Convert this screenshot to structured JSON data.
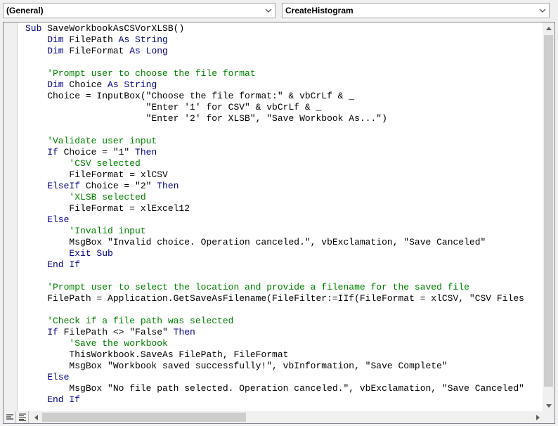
{
  "object_combo": {
    "value": "(General)"
  },
  "procedure_combo": {
    "value": "CreateHistogram"
  },
  "icons": {
    "dropdown": "chevron-down-icon",
    "procedure_view": "procedure-view-icon",
    "module_view": "full-module-view-icon"
  },
  "colors": {
    "keyword": "#00008b",
    "comment": "#008000",
    "text": "#000000"
  },
  "code_lines": [
    [
      {
        "t": "Sub ",
        "c": "kw"
      },
      {
        "t": "SaveWorkbookAsCSVorXLSB()",
        "c": "tx"
      }
    ],
    [
      {
        "t": "    Dim ",
        "c": "kw"
      },
      {
        "t": "FilePath ",
        "c": "tx"
      },
      {
        "t": "As String",
        "c": "kw"
      }
    ],
    [
      {
        "t": "    Dim ",
        "c": "kw"
      },
      {
        "t": "FileFormat ",
        "c": "tx"
      },
      {
        "t": "As Long",
        "c": "kw"
      }
    ],
    [],
    [
      {
        "t": "    'Prompt user to choose the file format",
        "c": "cm"
      }
    ],
    [
      {
        "t": "    Dim ",
        "c": "kw"
      },
      {
        "t": "Choice ",
        "c": "tx"
      },
      {
        "t": "As String",
        "c": "kw"
      }
    ],
    [
      {
        "t": "    Choice = InputBox(\"Choose the file format:\" & vbCrLf & _",
        "c": "tx"
      }
    ],
    [
      {
        "t": "                      \"Enter '1' for CSV\" & vbCrLf & _",
        "c": "tx"
      }
    ],
    [
      {
        "t": "                      \"Enter '2' for XLSB\", \"Save Workbook As...\")",
        "c": "tx"
      }
    ],
    [],
    [
      {
        "t": "    'Validate user input",
        "c": "cm"
      }
    ],
    [
      {
        "t": "    If ",
        "c": "kw"
      },
      {
        "t": "Choice = \"1\" ",
        "c": "tx"
      },
      {
        "t": "Then",
        "c": "kw"
      }
    ],
    [
      {
        "t": "        'CSV selected",
        "c": "cm"
      }
    ],
    [
      {
        "t": "        FileFormat = xlCSV",
        "c": "tx"
      }
    ],
    [
      {
        "t": "    ElseIf ",
        "c": "kw"
      },
      {
        "t": "Choice = \"2\" ",
        "c": "tx"
      },
      {
        "t": "Then",
        "c": "kw"
      }
    ],
    [
      {
        "t": "        'XLSB selected",
        "c": "cm"
      }
    ],
    [
      {
        "t": "        FileFormat = xlExcel12",
        "c": "tx"
      }
    ],
    [
      {
        "t": "    Else",
        "c": "kw"
      }
    ],
    [
      {
        "t": "        'Invalid input",
        "c": "cm"
      }
    ],
    [
      {
        "t": "        MsgBox \"Invalid choice. Operation canceled.\", vbExclamation, \"Save Canceled\"",
        "c": "tx"
      }
    ],
    [
      {
        "t": "        Exit Sub",
        "c": "kw"
      }
    ],
    [
      {
        "t": "    End If",
        "c": "kw"
      }
    ],
    [],
    [
      {
        "t": "    'Prompt user to select the location and provide a filename for the saved file",
        "c": "cm"
      }
    ],
    [
      {
        "t": "    FilePath = Application.GetSaveAsFilename(FileFilter:=IIf(FileFormat = xlCSV, \"CSV Files",
        "c": "tx"
      }
    ],
    [],
    [
      {
        "t": "    'Check if a file path was selected",
        "c": "cm"
      }
    ],
    [
      {
        "t": "    If ",
        "c": "kw"
      },
      {
        "t": "FilePath <> \"False\" ",
        "c": "tx"
      },
      {
        "t": "Then",
        "c": "kw"
      }
    ],
    [
      {
        "t": "        'Save the workbook",
        "c": "cm"
      }
    ],
    [
      {
        "t": "        ThisWorkbook.SaveAs FilePath, FileFormat",
        "c": "tx"
      }
    ],
    [
      {
        "t": "        MsgBox \"Workbook saved successfully!\", vbInformation, \"Save Complete\"",
        "c": "tx"
      }
    ],
    [
      {
        "t": "    Else",
        "c": "kw"
      }
    ],
    [
      {
        "t": "        MsgBox \"No file path selected. Operation canceled.\", vbExclamation, \"Save Canceled\"",
        "c": "tx"
      }
    ],
    [
      {
        "t": "    End If",
        "c": "kw"
      }
    ]
  ]
}
